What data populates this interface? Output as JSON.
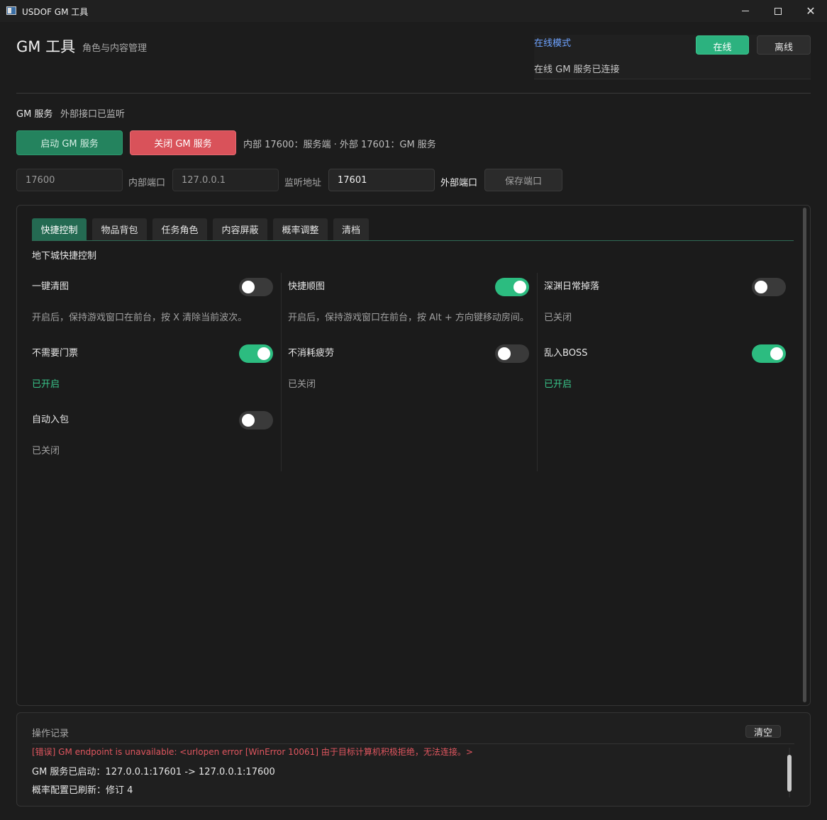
{
  "window": {
    "title": "USDOF GM 工具",
    "icon": "app-window-icon",
    "minimize_icon": "minimize-icon",
    "maximize_icon": "maximize-icon",
    "close_icon": "close-icon",
    "close_glyph": "✕"
  },
  "header": {
    "title": "GM 工具",
    "subtitle": "角色与内容管理"
  },
  "mode": {
    "label": "在线模式",
    "online_label": "在线",
    "offline_label": "离线",
    "status": "在线 GM 服务已连接",
    "accent": "#2cb27f"
  },
  "service": {
    "label": "GM 服务",
    "status": "外部接口已监听",
    "start_label": "启动 GM 服务",
    "stop_label": "关闭 GM 服务",
    "port_info": "内部 17600：服务端 · 外部 17601：GM 服务"
  },
  "ports": {
    "internal_value": "17600",
    "internal_label": "内部端口",
    "listen_value": "127.0.0.1",
    "listen_label": "监听地址",
    "external_value": "17601",
    "external_label": "外部端口",
    "save_label": "保存端口"
  },
  "tabs": [
    {
      "label": "快捷控制",
      "active": true
    },
    {
      "label": "物品背包",
      "active": false
    },
    {
      "label": "任务角色",
      "active": false
    },
    {
      "label": "内容屏蔽",
      "active": false
    },
    {
      "label": "概率调整",
      "active": false
    },
    {
      "label": "清档",
      "active": false
    }
  ],
  "section_title": "地下城快捷控制",
  "toggles": [
    {
      "label": "一键清图",
      "on": false,
      "desc": "开启后，保持游戏窗口在前台，按 X 清除当前波次。"
    },
    {
      "label": "快捷顺图",
      "on": true,
      "desc": "开启后，保持游戏窗口在前台，按 Alt + 方向键移动房间。"
    },
    {
      "label": "深渊日常掉落",
      "on": false,
      "desc": "已关闭"
    },
    {
      "label": "不需要门票",
      "on": true,
      "desc": "已开启"
    },
    {
      "label": "不消耗疲劳",
      "on": false,
      "desc": "已关闭"
    },
    {
      "label": "乱入BOSS",
      "on": true,
      "desc": "已开启"
    },
    {
      "label": "自动入包",
      "on": false,
      "desc": "已关闭"
    }
  ],
  "log": {
    "title": "操作记录",
    "clear_label": "清空",
    "lines": [
      "[错误] GM endpoint is unavailable: <urlopen error [WinError 10061] 由于目标计算机积极拒绝，无法连接。>",
      "GM 服务已启动：127.0.0.1:17601 -> 127.0.0.1:17600",
      "概率配置已刷新：修订 4"
    ],
    "error_color": "#e0565f"
  },
  "colors": {
    "toggle_on": "#2cbc80",
    "toggle_off": "#3a3a3a",
    "enabled_text": "#39c48a"
  }
}
